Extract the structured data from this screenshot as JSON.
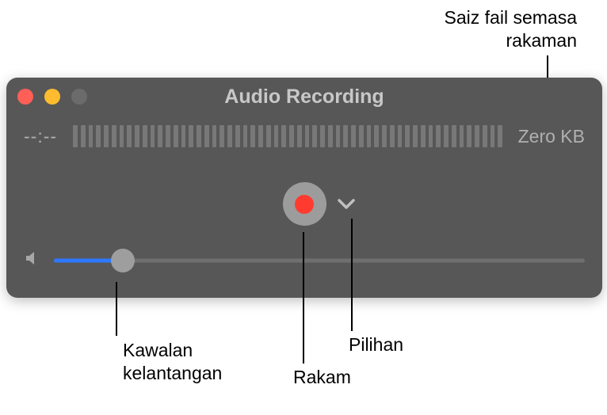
{
  "annotations": {
    "top": "Saiz fail semasa\nrakaman",
    "kawalan": "Kawalan\nkelantangan",
    "rakam": "Rakam",
    "pilihan": "Pilihan"
  },
  "window": {
    "title": "Audio Recording",
    "time_display": "--:--",
    "file_size": "Zero KB",
    "volume_percent": 13,
    "meter_ticks": 56
  }
}
